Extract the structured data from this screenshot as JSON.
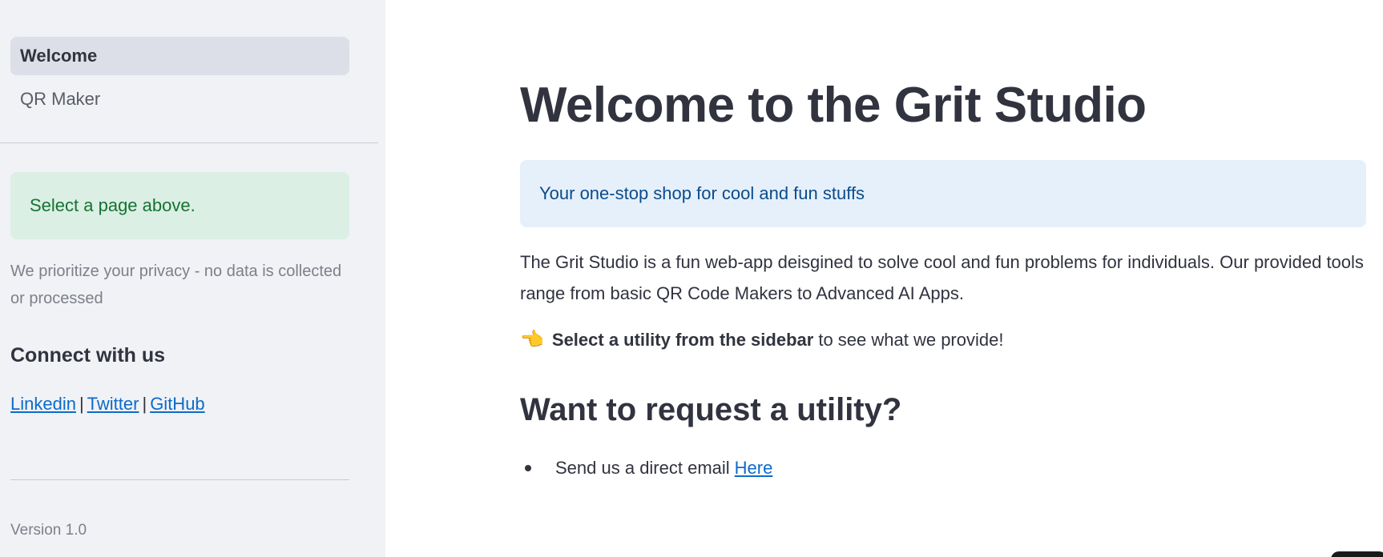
{
  "sidebar": {
    "nav": [
      {
        "label": "Welcome"
      },
      {
        "label": "QR Maker"
      }
    ],
    "success_message": "Select a page above.",
    "privacy_note": "We prioritize your privacy - no data is collected or processed",
    "connect_heading": "Connect with us",
    "links": {
      "linkedin": "Linkedin",
      "twitter": "Twitter",
      "github": "GitHub",
      "separator": "|"
    },
    "version": "Version 1.0"
  },
  "main": {
    "title": "Welcome to the Grit Studio",
    "info_box": "Your one-stop shop for cool and fun stuffs",
    "description": "The Grit Studio is a fun web-app deisgined to solve cool and fun problems for individuals. Our provided tools range from basic QR Code Makers to Advanced AI Apps.",
    "cta_icon": "👈",
    "cta_bold": "Select a utility from the sidebar",
    "cta_rest": "to see what we provide!",
    "request_heading": "Want to request a utility?",
    "bullet_text": "Send us a direct email",
    "bullet_link": "Here"
  },
  "colors": {
    "sidebar_bg": "#f0f2f6",
    "success_bg": "#dbefe4",
    "success_text": "#177233",
    "info_bg": "#e6f0fb",
    "info_text": "#0a4c8b",
    "link": "#0d6bc9"
  }
}
